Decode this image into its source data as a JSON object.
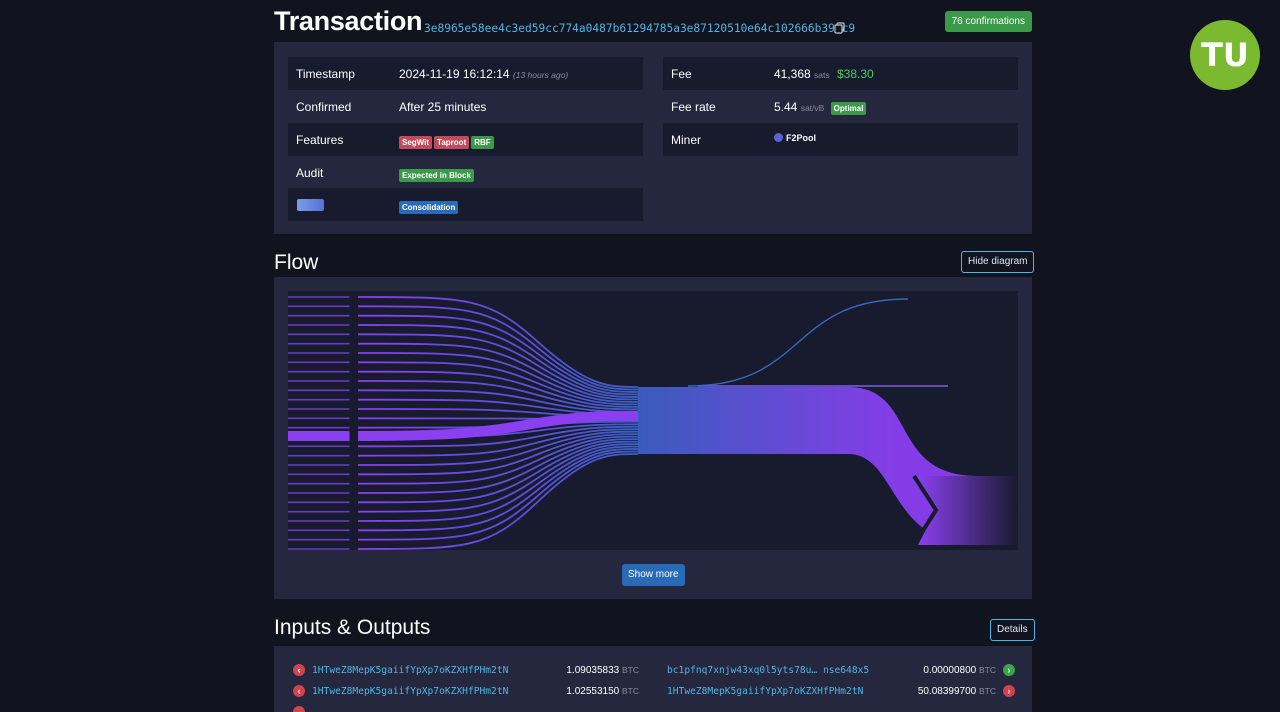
{
  "header": {
    "title": "Transaction",
    "txid": "3e8965e58ee4c3ed59cc774a0487b61294785a3e87120510e64c102666b39ec9",
    "confirmations": "76 confirmations"
  },
  "details": {
    "timestamp_label": "Timestamp",
    "timestamp_value": "2024-11-19 16:12:14",
    "timestamp_ago": "(13 hours ago)",
    "confirmed_label": "Confirmed",
    "confirmed_value": "After 25 minutes",
    "features_label": "Features",
    "features": [
      "SegWit",
      "Taproot",
      "RBF"
    ],
    "audit_label": "Audit",
    "audit_badge": "Expected in Block",
    "tx_type_badge": "Consolidation",
    "fee_label": "Fee",
    "fee_sats": "41,368",
    "fee_sats_unit": "sats",
    "fee_usd": "$38.30",
    "feerate_label": "Fee rate",
    "feerate_value": "5.44",
    "feerate_unit": "sat/vB",
    "feerate_badge": "Optimal",
    "miner_label": "Miner",
    "miner_value": "F2Pool"
  },
  "flow": {
    "title": "Flow",
    "hide_button": "Hide diagram",
    "show_more_button": "Show more"
  },
  "io": {
    "title": "Inputs & Outputs",
    "details_button": "Details",
    "inputs": [
      {
        "address": "1HTweZ8MepK5gaiifYpXp7oKZXHfPHm2tN",
        "amount": "1.09035833",
        "unit": "BTC"
      },
      {
        "address": "1HTweZ8MepK5gaiifYpXp7oKZXHfPHm2tN",
        "amount": "1.02553150",
        "unit": "BTC"
      }
    ],
    "outputs": [
      {
        "address": "bc1pfnq7xnjw43xq0l5yts78u… nse648x5",
        "amount": "0.00000800",
        "unit": "BTC"
      },
      {
        "address": "1HTweZ8MepK5gaiifYpXp7oKZXHfPHm2tN",
        "amount": "50.08399700",
        "unit": "BTC"
      }
    ]
  },
  "logo": {
    "text": "TU"
  },
  "colors": {
    "background": "#11131f",
    "panel": "#24273e",
    "row_dark": "#181b2d",
    "link": "#4fb6e3",
    "green": "#3a9a4a",
    "red": "#c14b5a",
    "blue": "#2a6bb8",
    "flow_purple": "#8a3ff0",
    "flow_blue": "#3b5fc4"
  },
  "icons": {
    "copy": "copy-icon",
    "miner": "f2pool-icon",
    "input_arrow": "arrow-left-icon",
    "output_arrow": "arrow-right-icon"
  }
}
